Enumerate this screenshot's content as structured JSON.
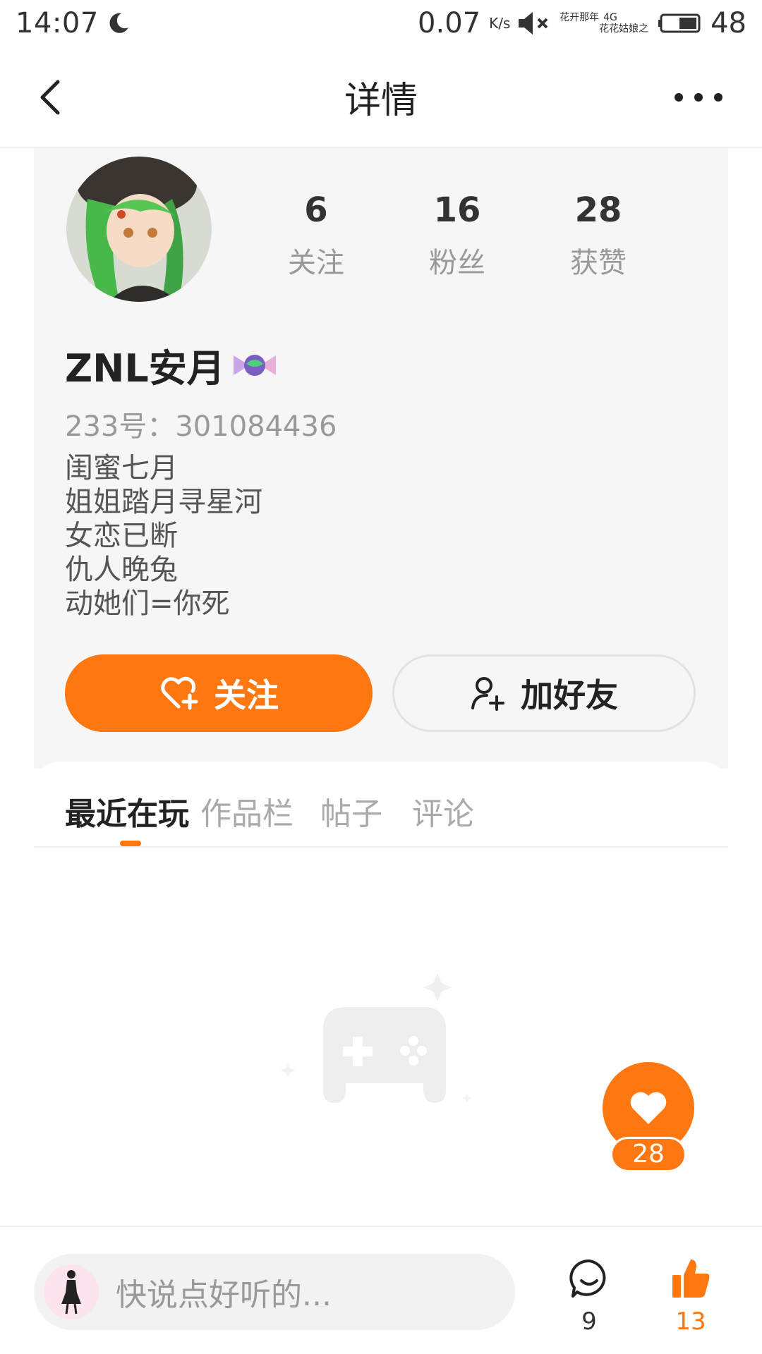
{
  "status_bar": {
    "time": "14:07",
    "net_speed": "0.07",
    "net_unit": "K/s",
    "carrier_top": "花开那年",
    "network_type": "4G",
    "carrier_bottom": "花花姑娘之",
    "battery": "48"
  },
  "nav": {
    "title": "详情"
  },
  "profile": {
    "stats": [
      {
        "value": "6",
        "label": "关注"
      },
      {
        "value": "16",
        "label": "粉丝"
      },
      {
        "value": "28",
        "label": "获赞"
      }
    ],
    "username": "ZNL安月",
    "user_id": "233号：301084436",
    "bio": [
      "闺蜜七月",
      "姐姐踏月寻星河",
      "女恋已断",
      "仇人晚兔",
      "动她们=你死"
    ],
    "follow_label": "关注",
    "add_friend_label": "加好友"
  },
  "tabs": [
    {
      "label": "最近在玩",
      "active": true
    },
    {
      "label": "作品栏",
      "active": false
    },
    {
      "label": "帖子",
      "active": false
    },
    {
      "label": "评论",
      "active": false
    }
  ],
  "floating_like": {
    "count": "28"
  },
  "bottom_bar": {
    "placeholder": "快说点好听的...",
    "comment_count": "9",
    "like_count": "13"
  },
  "colors": {
    "accent": "#ff7711",
    "card_background": "#f6f6f6",
    "muted_text": "#999999"
  }
}
